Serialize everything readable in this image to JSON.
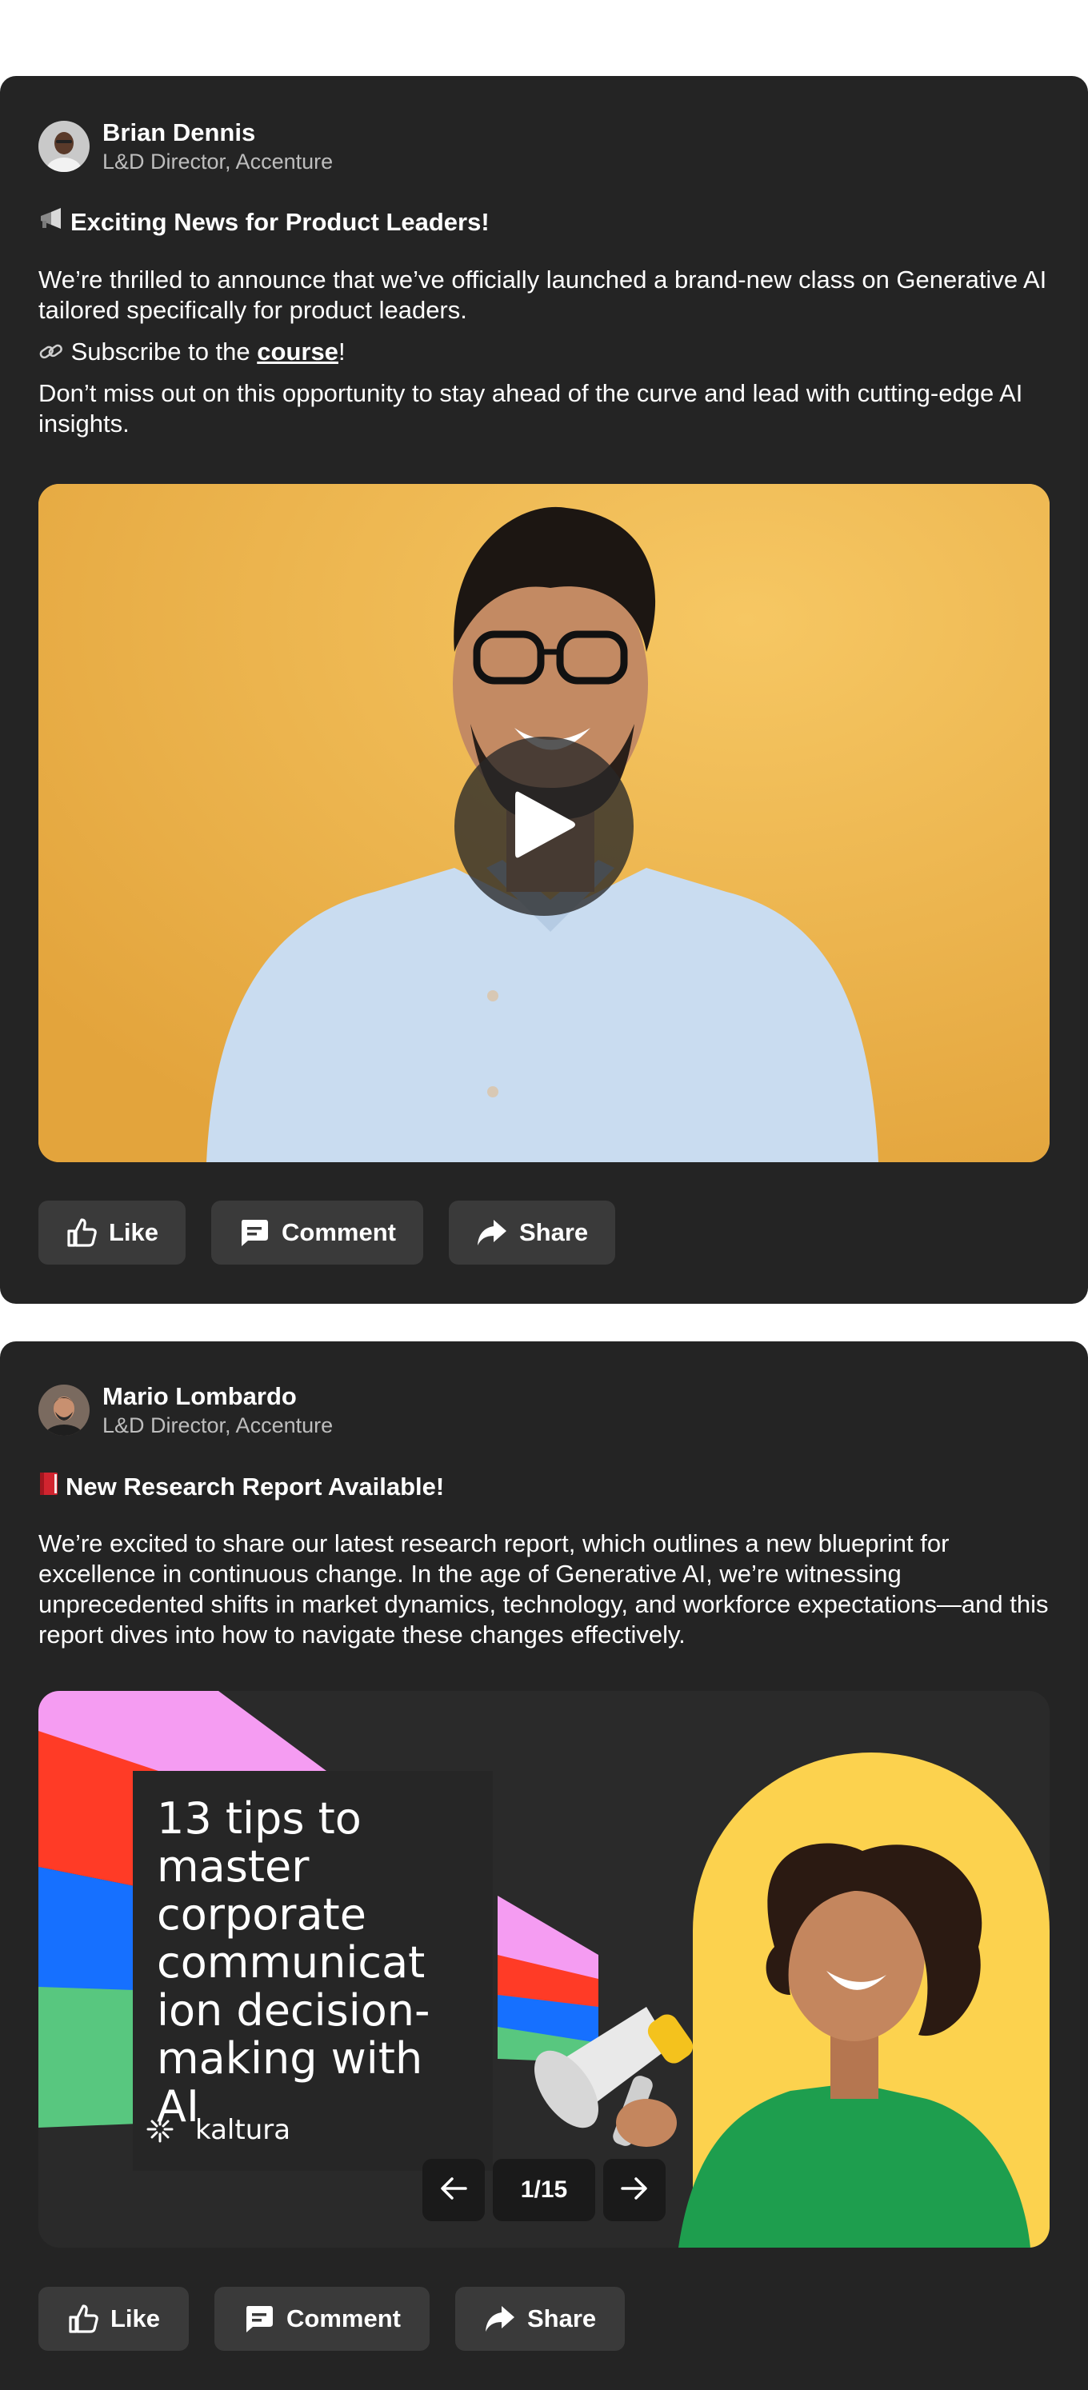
{
  "posts": [
    {
      "author": {
        "name": "Brian Dennis",
        "role": "L&D Director, Accenture"
      },
      "title": "Exciting News for Product Leaders!",
      "title_icon": "megaphone-icon",
      "body_1": "We’re thrilled to announce that we’ve officially launched a brand-new class on Generative AI tailored specifically for product leaders.",
      "subscribe_prefix": "Subscribe to the ",
      "subscribe_link": "course",
      "subscribe_suffix": "!",
      "body_2": "Don’t miss out on this opportunity to stay ahead of the curve and lead with cutting-edge AI insights.",
      "media_type": "video",
      "actions": {
        "like": "Like",
        "comment": "Comment",
        "share": "Share"
      }
    },
    {
      "author": {
        "name": "Mario Lombardo",
        "role": "L&D Director, Accenture"
      },
      "title": "New Research Report Available!",
      "title_icon": "red-book-icon",
      "body_1": "We’re excited to share our latest research report, which outlines a new blueprint for excellence in continuous change. In the age of Generative AI, we’re witnessing unprecedented shifts in market dynamics, technology, and workforce expectations—and this report dives into how to navigate these changes effectively.",
      "slide": {
        "title": "13 tips to master corporate communicat ion decision-making with AI",
        "brand": "kaltura",
        "page": "1/15"
      },
      "actions": {
        "like": "Like",
        "comment": "Comment",
        "share": "Share"
      }
    }
  ],
  "colors": {
    "card_bg": "#242424",
    "button_bg": "#3a3a3a",
    "video_bg": "#ebb34a",
    "slide_yellow": "#fcd24e",
    "slide_pink": "#f59cf2",
    "slide_red": "#ff3b26",
    "slide_blue": "#1670ff",
    "slide_green": "#58c77f"
  }
}
